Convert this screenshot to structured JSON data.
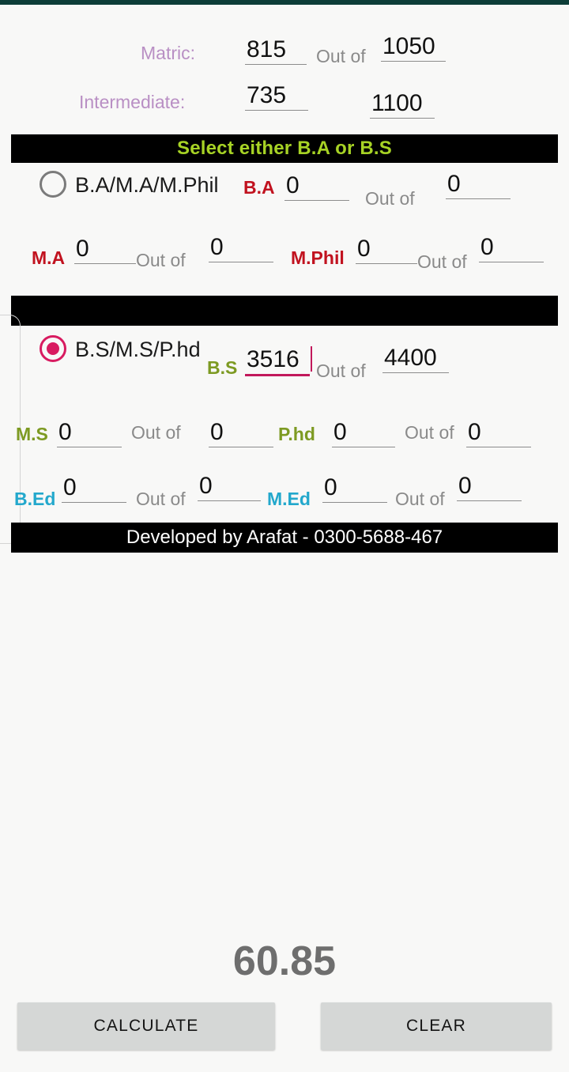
{
  "app": {
    "background": "#f8f8f7",
    "status_strip_color": "#0d3d38"
  },
  "header": {
    "rows": [
      {
        "label": "Matric:",
        "obtained": "815",
        "outof_text": "Out of",
        "total": "1050"
      },
      {
        "label": "Intermediate:",
        "obtained": "735",
        "outof_text": "",
        "total": "1100"
      }
    ],
    "label_color": "#b98fc4"
  },
  "select_banner": {
    "title": "Select either B.A or B.S",
    "title_color": "#a7d325",
    "background": "#000000"
  },
  "divider_banner": {
    "title": "",
    "background": "#000000"
  },
  "ba_group": {
    "radio_label": "B.A/M.A/M.Phil",
    "selected": false,
    "fields": [
      {
        "tag": "B.A",
        "tag_color": "#c1121f",
        "value": "0",
        "outof_text": "Out of",
        "total": "0"
      },
      {
        "tag": "M.A",
        "tag_color": "#c1121f",
        "value": "0",
        "outof_text": "Out of",
        "total": "0"
      },
      {
        "tag": "M.Phil",
        "tag_color": "#c1121f",
        "value": "0",
        "outof_text": "Out of",
        "total": "0"
      }
    ]
  },
  "bs_group": {
    "radio_label": "B.S/M.S/P.hd",
    "selected": true,
    "radio_color": "#d81b60",
    "fields": [
      {
        "tag": "B.S",
        "tag_color": "#7d9a22",
        "value": "3516",
        "outof_text": "Out of",
        "total": "4400",
        "focused": true
      },
      {
        "tag": "M.S",
        "tag_color": "#7d9a22",
        "value": "0",
        "outof_text": "Out of",
        "total": "0",
        "focused": false
      },
      {
        "tag": "P.hd",
        "tag_color": "#7d9a22",
        "value": "0",
        "outof_text": "Out of",
        "total": "0",
        "focused": false
      },
      {
        "tag": "B.Ed",
        "tag_color": "#23a8cc",
        "value": "0",
        "outof_text": "Out of",
        "total": "0",
        "focused": false
      },
      {
        "tag": "M.Ed",
        "tag_color": "#23a8cc",
        "value": "0",
        "outof_text": "Out of",
        "total": "0",
        "focused": false
      }
    ]
  },
  "credit_banner": {
    "text": "Developed by Arafat - 0300-5688-467",
    "background": "#000000",
    "text_color": "#ffffff"
  },
  "result": {
    "value": "60.85",
    "color": "#6e6e6e"
  },
  "actions": {
    "calculate_label": "CALCULATE",
    "clear_label": "CLEAR",
    "button_background": "#d5d7d6"
  }
}
